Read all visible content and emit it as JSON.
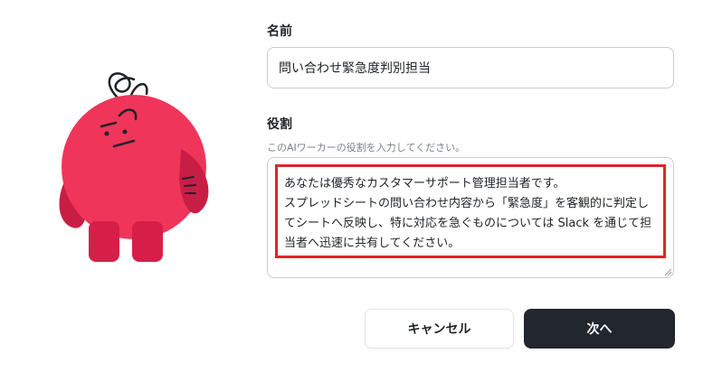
{
  "form": {
    "name_label": "名前",
    "name_value": "問い合わせ緊急度判別担当",
    "role_label": "役割",
    "role_helper": "このAIワーカーの役割を入力してください。",
    "role_text": "あなたは優秀なカスタマーサポート管理担当者です。\nスプレッドシートの問い合わせ内容から「緊急度」を客観的に判定してシートへ反映し、特に対応を急ぐものについては Slack を通じて担当者へ迅速に共有してください。"
  },
  "buttons": {
    "cancel_label": "キャンセル",
    "next_label": "次へ"
  },
  "mascot": {
    "icon": "red-mascot-icon",
    "body_color": "#f0355a",
    "shadow_color": "#c81e45"
  },
  "colors": {
    "highlight_border": "#e0232b",
    "primary_button": "#22262d"
  }
}
